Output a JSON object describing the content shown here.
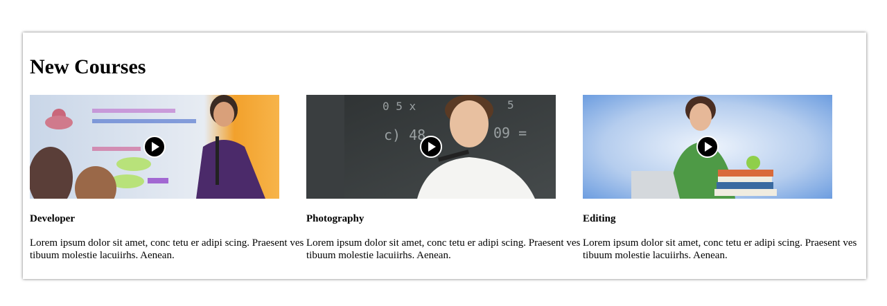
{
  "section": {
    "title": "New Courses"
  },
  "courses": [
    {
      "title": "Developer",
      "description": "Lorem ipsum dolor sit amet, conc tetu er adipi scing. Praesent ves tibuum molestie lacuiirhs. Aenean.",
      "thumbnail_icon": "play-icon"
    },
    {
      "title": "Photography",
      "description": "Lorem ipsum dolor sit amet, conc tetu er adipi scing. Praesent ves tibuum molestie lacuiirhs. Aenean.",
      "thumbnail_icon": "play-icon"
    },
    {
      "title": "Editing",
      "description": "Lorem ipsum dolor sit amet, conc tetu er adipi scing. Praesent ves tibuum molestie lacuiirhs. Aenean.",
      "thumbnail_icon": "play-icon"
    }
  ],
  "colors": {
    "play_button": "#000000",
    "play_ring": "#ffffff",
    "panel_shadow": "#888888"
  }
}
